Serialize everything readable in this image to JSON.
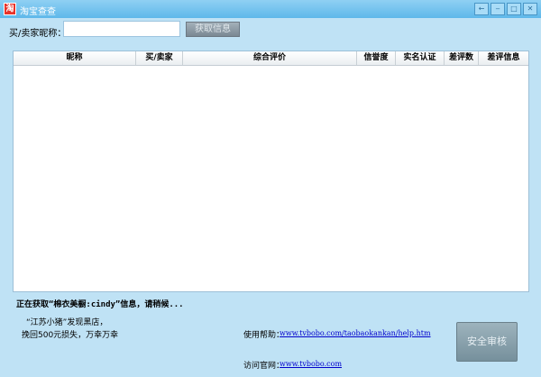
{
  "window": {
    "title": "淘宝查查",
    "app_icon_glyph": "淘",
    "controls": [
      "←",
      "‒",
      "□",
      "✕"
    ]
  },
  "search": {
    "label": "买/卖家昵称：",
    "value": "",
    "fetch_button": "获取信息"
  },
  "table": {
    "columns": [
      "昵称",
      "买/卖家",
      "综合评价",
      "信誉度",
      "实名认证",
      "差评数",
      "差评信息"
    ],
    "rows": []
  },
  "status": "正在获取“棉衣美橱:cindy”信息，请稍候...",
  "notice": {
    "line1": "“江苏小猪”发现黑店，",
    "line2": "挽回500元损失，万幸万幸"
  },
  "help": {
    "label": "使用帮助：",
    "link": "www.tvbobo.com/taobaokankan/help.htm"
  },
  "site": {
    "label": "访问官网：",
    "link": "www.tvbobo.com"
  },
  "secure_button": "安全审核",
  "colors": {
    "background": "#bfe2f5",
    "titlebar": "#5eb8ea",
    "link": "#0000cc"
  }
}
